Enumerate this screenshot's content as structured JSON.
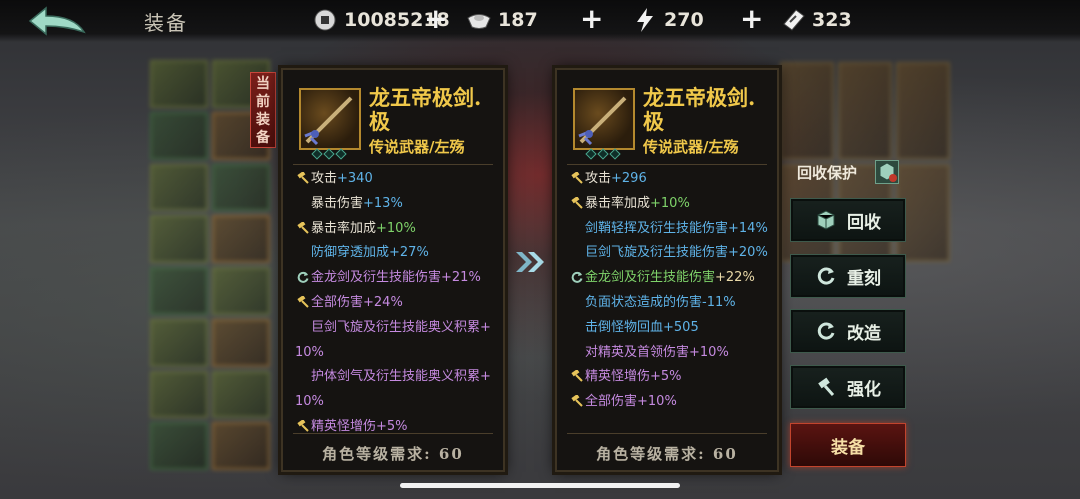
{
  "header": {
    "back_icon": "back-arrow-icon",
    "title": "装备",
    "resources": [
      {
        "icon": "coin-icon",
        "value": "10085218"
      },
      {
        "icon": "ingot-icon",
        "value": "187"
      },
      {
        "icon": "stamina-icon",
        "value": "270"
      },
      {
        "icon": "ticket-icon",
        "value": "323"
      }
    ],
    "plus_label": "+"
  },
  "current": {
    "badge": "当前装备",
    "name": "龙五帝极剑.极",
    "type": "传说武器/左殇",
    "stats": [
      {
        "marker": "hammer",
        "text": "攻击",
        "value": "+340",
        "label_color": "white",
        "value_color": "blue"
      },
      {
        "marker": "",
        "text": "暴击伤害",
        "value": "+13%",
        "label_color": "white",
        "value_color": "blue"
      },
      {
        "marker": "hammer",
        "text": "暴击率加成",
        "value": "+10%",
        "label_color": "white",
        "value_color": "green"
      },
      {
        "marker": "",
        "text": "防御穿透加成",
        "value": "+27%",
        "label_color": "blue",
        "value_color": "blue"
      },
      {
        "marker": "refresh",
        "text": "金龙剑及衍生技能伤害",
        "value": "+21%",
        "label_color": "purple",
        "value_color": "purple"
      },
      {
        "marker": "hammer",
        "text": "全部伤害",
        "value": "+24%",
        "label_color": "purple",
        "value_color": "purple"
      },
      {
        "marker": "",
        "text": "巨剑飞旋及衍生技能奥义积累+",
        "value": "",
        "label_color": "purple",
        "value_color": "purple"
      },
      {
        "marker": "",
        "text": "10%",
        "value": "",
        "label_color": "purple",
        "value_color": "purple",
        "flush": true
      },
      {
        "marker": "",
        "text": "护体剑气及衍生技能奥义积累+",
        "value": "",
        "label_color": "purple",
        "value_color": "purple"
      },
      {
        "marker": "",
        "text": "10%",
        "value": "",
        "label_color": "purple",
        "value_color": "purple",
        "flush": true
      },
      {
        "marker": "hammer",
        "text": "精英怪增伤",
        "value": "+5%",
        "label_color": "purple",
        "value_color": "purple"
      }
    ],
    "requirement": "角色等级需求: 60"
  },
  "compare": {
    "name": "龙五帝极剑.极",
    "type": "传说武器/左殇",
    "stats": [
      {
        "marker": "hammer",
        "text": "攻击",
        "value": "+296",
        "label_color": "white",
        "value_color": "blue"
      },
      {
        "marker": "hammer",
        "text": "暴击率加成",
        "value": "+10%",
        "label_color": "white",
        "value_color": "green"
      },
      {
        "marker": "",
        "text": "剑鞘轻挥及衍生技能伤害",
        "value": "+14%",
        "label_color": "blue",
        "value_color": "blue"
      },
      {
        "marker": "",
        "text": "巨剑飞旋及衍生技能伤害",
        "value": "+20%",
        "label_color": "blue",
        "value_color": "blue"
      },
      {
        "marker": "refresh",
        "text": "金龙剑及衍生技能伤害",
        "value": "+22%",
        "label_color": "green",
        "value_color": "gold"
      },
      {
        "marker": "",
        "text": "负面状态造成的伤害",
        "value": "-11%",
        "label_color": "blue",
        "value_color": "blue"
      },
      {
        "marker": "",
        "text": "击倒怪物回血",
        "value": "+505",
        "label_color": "blue",
        "value_color": "blue"
      },
      {
        "marker": "",
        "text": "对精英及首领伤害",
        "value": "+10%",
        "label_color": "purple",
        "value_color": "purple"
      },
      {
        "marker": "hammer",
        "text": "精英怪增伤",
        "value": "+5%",
        "label_color": "purple",
        "value_color": "purple"
      },
      {
        "marker": "hammer",
        "text": "全部伤害",
        "value": "+10%",
        "label_color": "purple",
        "value_color": "purple"
      }
    ],
    "requirement": "角色等级需求: 60"
  },
  "actions": {
    "recycle_protect_label": "回收保护",
    "recycle": "回收",
    "reforge": "重刻",
    "modify": "改造",
    "enhance": "强化",
    "equip": "装备"
  },
  "colors": {
    "gold": "#f0c84a",
    "blue": "#5fb3e8",
    "green": "#7fd36a",
    "purple": "#c58ae0",
    "white": "#e6e0d2",
    "equip_red": "#c2442d"
  }
}
